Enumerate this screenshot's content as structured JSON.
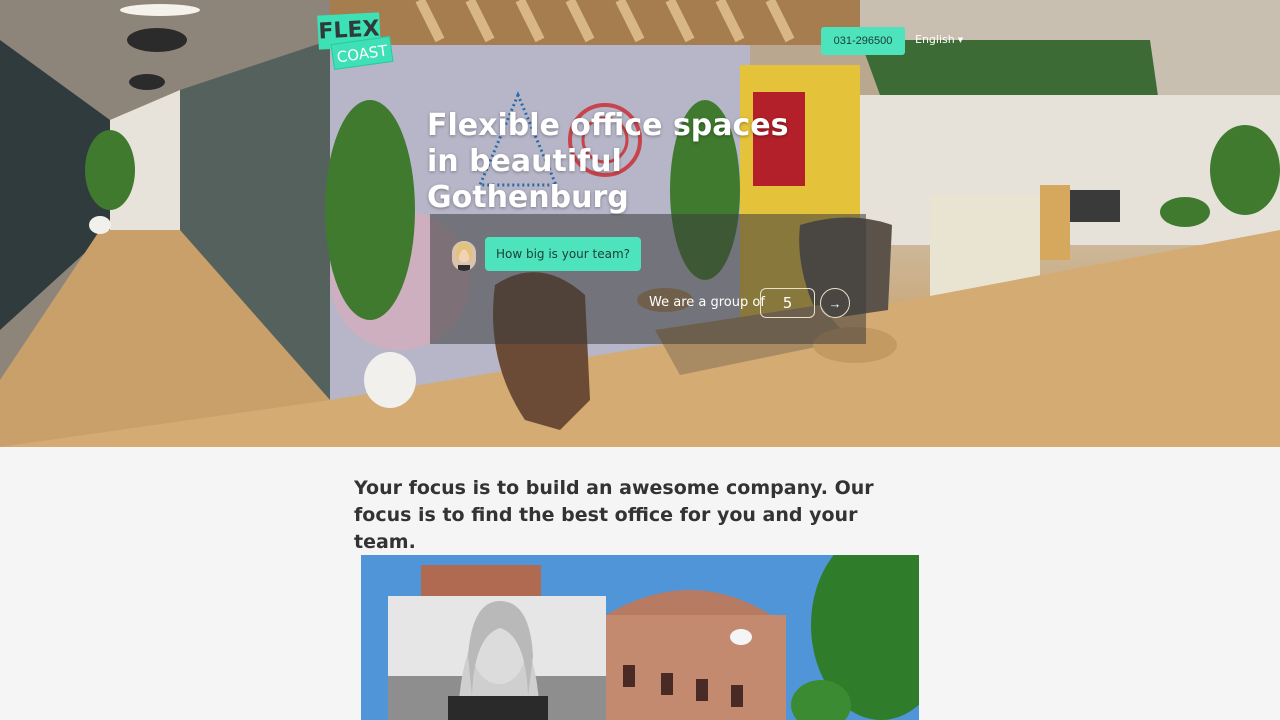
{
  "brand": {
    "logo_top": "FLEX",
    "logo_bottom": "COAST"
  },
  "header": {
    "phone": "031-296500",
    "language": "English"
  },
  "hero": {
    "title": "Flexible office spaces in beautiful Gothenburg",
    "chat": {
      "question": "How big is your team?",
      "answer_label": "We are a group of",
      "answer_value": "5",
      "next_icon": "arrow-right-icon"
    }
  },
  "main": {
    "tagline": "Your focus is to build an awesome company. Our focus is to find the best office for you and your team."
  },
  "colors": {
    "accent": "#4de3bd",
    "text": "#333333",
    "background": "#f5f5f5"
  }
}
